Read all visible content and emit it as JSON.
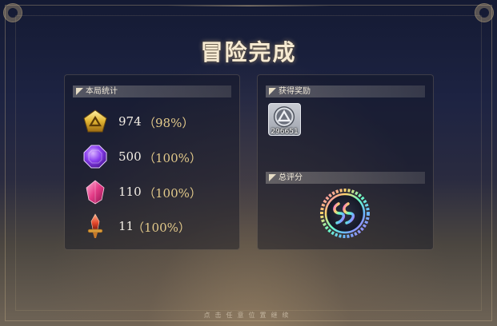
{
  "title": "冒险完成",
  "stats_panel": {
    "header": "本局统计",
    "rows": [
      {
        "icon": "gold-pentagon-icon",
        "value": "974",
        "percent": "（98%）"
      },
      {
        "icon": "purple-octagon-gem-icon",
        "value": "500",
        "percent": "（100%）"
      },
      {
        "icon": "pink-crystal-icon",
        "value": "110",
        "percent": "（100%）"
      },
      {
        "icon": "fire-relic-icon",
        "value": "11",
        "percent": "（100%）"
      }
    ]
  },
  "rewards_panel": {
    "header": "获得奖励",
    "item": {
      "icon": "silver-rune-coin-icon",
      "count": "296651"
    }
  },
  "rating_panel": {
    "header": "总评分",
    "badge": "rainbow-rating-emblem-icon"
  },
  "footer_hint": "点击任意位置继续",
  "colors": {
    "title": "#f6ead2",
    "percent": "#e2c98a",
    "value": "#f4efe6"
  }
}
